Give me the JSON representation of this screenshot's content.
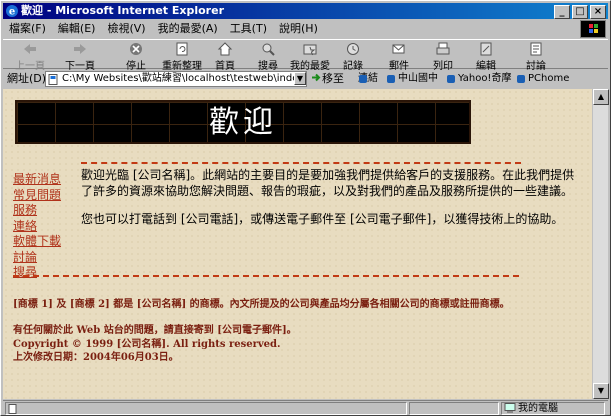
{
  "window": {
    "title": "歡迎 - Microsoft Internet Explorer",
    "minimize": "_",
    "maximize": "□",
    "close": "×"
  },
  "menu": [
    "檔案(F)",
    "編輯(E)",
    "檢視(V)",
    "我的最愛(A)",
    "工具(T)",
    "說明(H)"
  ],
  "toolbar": {
    "back": "上一頁",
    "forward": "下一頁",
    "stop": "停止",
    "refresh": "重新整理",
    "home": "首頁",
    "search": "搜尋",
    "favorites": "我的最愛",
    "history": "記錄",
    "mail": "郵件",
    "print": "列印",
    "edit": "編輯",
    "discuss": "討論"
  },
  "address": {
    "label": "網址(D)",
    "value": "C:\\My Websites\\歡站練習\\localhost\\testweb\\index.html",
    "go": "移至",
    "links_label": "連結",
    "links": [
      "中山國中",
      "Yahoo!奇摩",
      "PChome"
    ]
  },
  "page": {
    "banner_title": "歡迎",
    "nav": [
      "最新消息",
      "常見問題",
      "服務",
      "連絡",
      "軟體下載",
      "討論",
      "搜尋"
    ],
    "paragraph1": "歡迎光臨 [公司名稱]。此網站的主要目的是要加強我們提供給客戶的支援服務。在此我們提供了許多的資源來協助您解決問題、報告的瑕疵，以及對我們的產品及服務所提供的一些建議。",
    "paragraph2": "您也可以打電話到 [公司電話]，或傳送電子郵件至 [公司電子郵件]，以獲得技術上的協助。",
    "trademark": "[商標 1] 及 [商標 2] 都是 [公司名稱] 的商標。內文所提及的公司與產品均分屬各相關公司的商標或註冊商標。",
    "contact": "有任何關於此 Web 站台的問題，請直接寄到 [公司電子郵件]。",
    "copyright": "Copyright © 1999 [公司名稱]. All rights reserved.",
    "modified": "上次修改日期：2004年06月03日。"
  },
  "status": {
    "zone": "我的電腦"
  },
  "colors": {
    "title_bar": "#000080",
    "link": "#b0321a",
    "rule": "#c23a14",
    "footer_text": "#7a1f10",
    "background": "#e8dcc0"
  }
}
